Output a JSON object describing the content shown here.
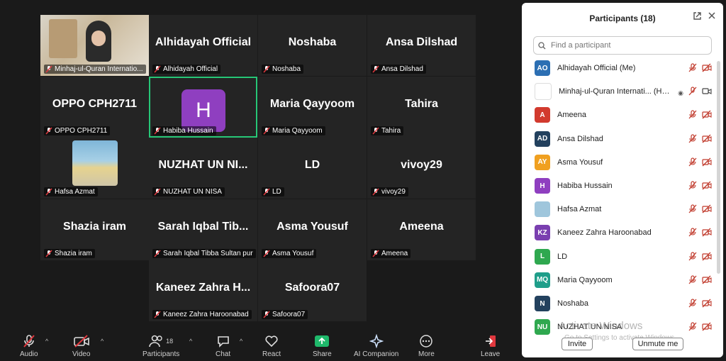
{
  "tiles": [
    {
      "label": "Minhaj-ul-Quran Internatio..."
    },
    {
      "name": "Alhidayah Official",
      "label": "Alhidayah Official"
    },
    {
      "name": "Noshaba",
      "label": "Noshaba"
    },
    {
      "name": "Ansa Dilshad",
      "label": "Ansa Dilshad"
    },
    {
      "name": "OPPO CPH2711",
      "label": "OPPO CPH2711"
    },
    {
      "avatar_letter": "H",
      "label": "Habiba Hussain"
    },
    {
      "name": "Maria Qayyoom",
      "label": "Maria Qayyoom"
    },
    {
      "name": "Tahira",
      "label": "Tahira"
    },
    {
      "label": "Hafsa Azmat"
    },
    {
      "name": "NUZHAT UN NI...",
      "label": "NUZHAT UN NISA"
    },
    {
      "name": "LD",
      "label": "LD"
    },
    {
      "name": "vivoy29",
      "label": "vivoy29"
    },
    {
      "name": "Shazia iram",
      "label": "Shazia iram"
    },
    {
      "name": "Sarah  Iqbal  Tib...",
      "label": "Sarah Iqbal Tibba Sultan pur"
    },
    {
      "name": "Asma Yousuf",
      "label": "Asma Yousuf"
    },
    {
      "name": "Ameena",
      "label": "Ameena"
    },
    {
      "name": "Kaneez  Zahra  H...",
      "label": "Kaneez Zahra Haroonabad"
    },
    {
      "name": "Safoora07",
      "label": "Safoora07"
    }
  ],
  "panel": {
    "title": "Participants (18)",
    "search_placeholder": "Find a participant",
    "participants": [
      {
        "initials": "AO",
        "color": "#2c6fb3",
        "name": "Alhidayah Official (Me)"
      },
      {
        "initials": "",
        "color": "#ffffff",
        "name": "Minhaj-ul-Quran Internati... (Host)"
      },
      {
        "initials": "A",
        "color": "#d23a2e",
        "name": "Ameena"
      },
      {
        "initials": "AD",
        "color": "#23415e",
        "name": "Ansa Dilshad"
      },
      {
        "initials": "AY",
        "color": "#f0a020",
        "name": "Asma Yousuf"
      },
      {
        "initials": "H",
        "color": "#8f3fc0",
        "name": "Habiba Hussain"
      },
      {
        "initials": "",
        "color": "#9fc6dc",
        "name": "Hafsa Azmat"
      },
      {
        "initials": "KZ",
        "color": "#7a3fb0",
        "name": "Kaneez Zahra Haroonabad"
      },
      {
        "initials": "L",
        "color": "#2fa84f",
        "name": "LD"
      },
      {
        "initials": "MQ",
        "color": "#1f9e8a",
        "name": "Maria Qayyoom"
      },
      {
        "initials": "N",
        "color": "#23415e",
        "name": "Noshaba"
      },
      {
        "initials": "NU",
        "color": "#2fa84f",
        "name": "NUZHAT UN NISA"
      }
    ],
    "invite_label": "Invite",
    "unmute_label": "Unmute me",
    "watermark_title": "Activate Windows",
    "watermark_sub": "Go to Settings to activate Windows."
  },
  "toolbar": {
    "audio": "Audio",
    "video": "Video",
    "participants": "Participants",
    "participants_count": "18",
    "chat": "Chat",
    "react": "React",
    "share": "Share",
    "ai": "AI Companion",
    "more": "More",
    "leave": "Leave"
  },
  "colors": {
    "accent_green": "#27c777",
    "share_green": "#1fb96b",
    "muted_red": "#e0383e"
  },
  "icons": {
    "mic": "mic-off-icon",
    "video": "video-off-icon",
    "search": "search-icon",
    "popout": "popout-icon",
    "close": "close-icon"
  }
}
